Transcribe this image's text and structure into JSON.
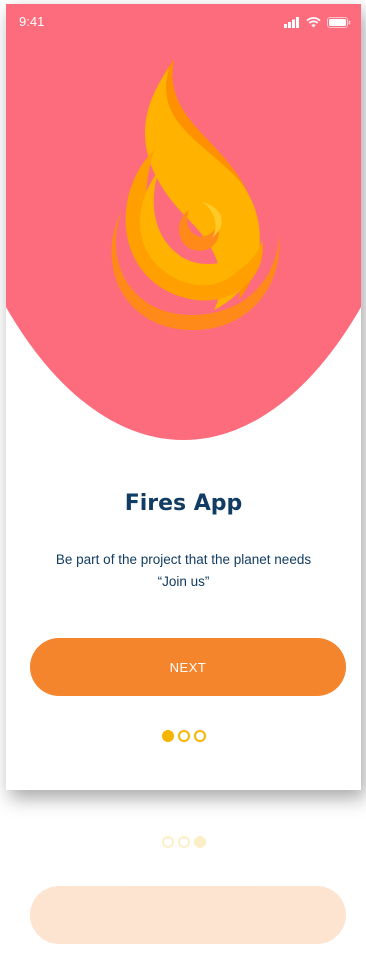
{
  "status_bar": {
    "time": "9:41"
  },
  "hero": {
    "logo_icon": "flame-icon",
    "background_color": "#fd6c7d"
  },
  "content": {
    "title": "Fires App",
    "subtitle_line1": "Be part of the project that the planet needs",
    "subtitle_line2": "“Join us”"
  },
  "actions": {
    "next_label": "NEXT",
    "button_color": "#f4852c"
  },
  "pagination": {
    "total": 3,
    "current": 1,
    "active_color": "#f4b400"
  }
}
